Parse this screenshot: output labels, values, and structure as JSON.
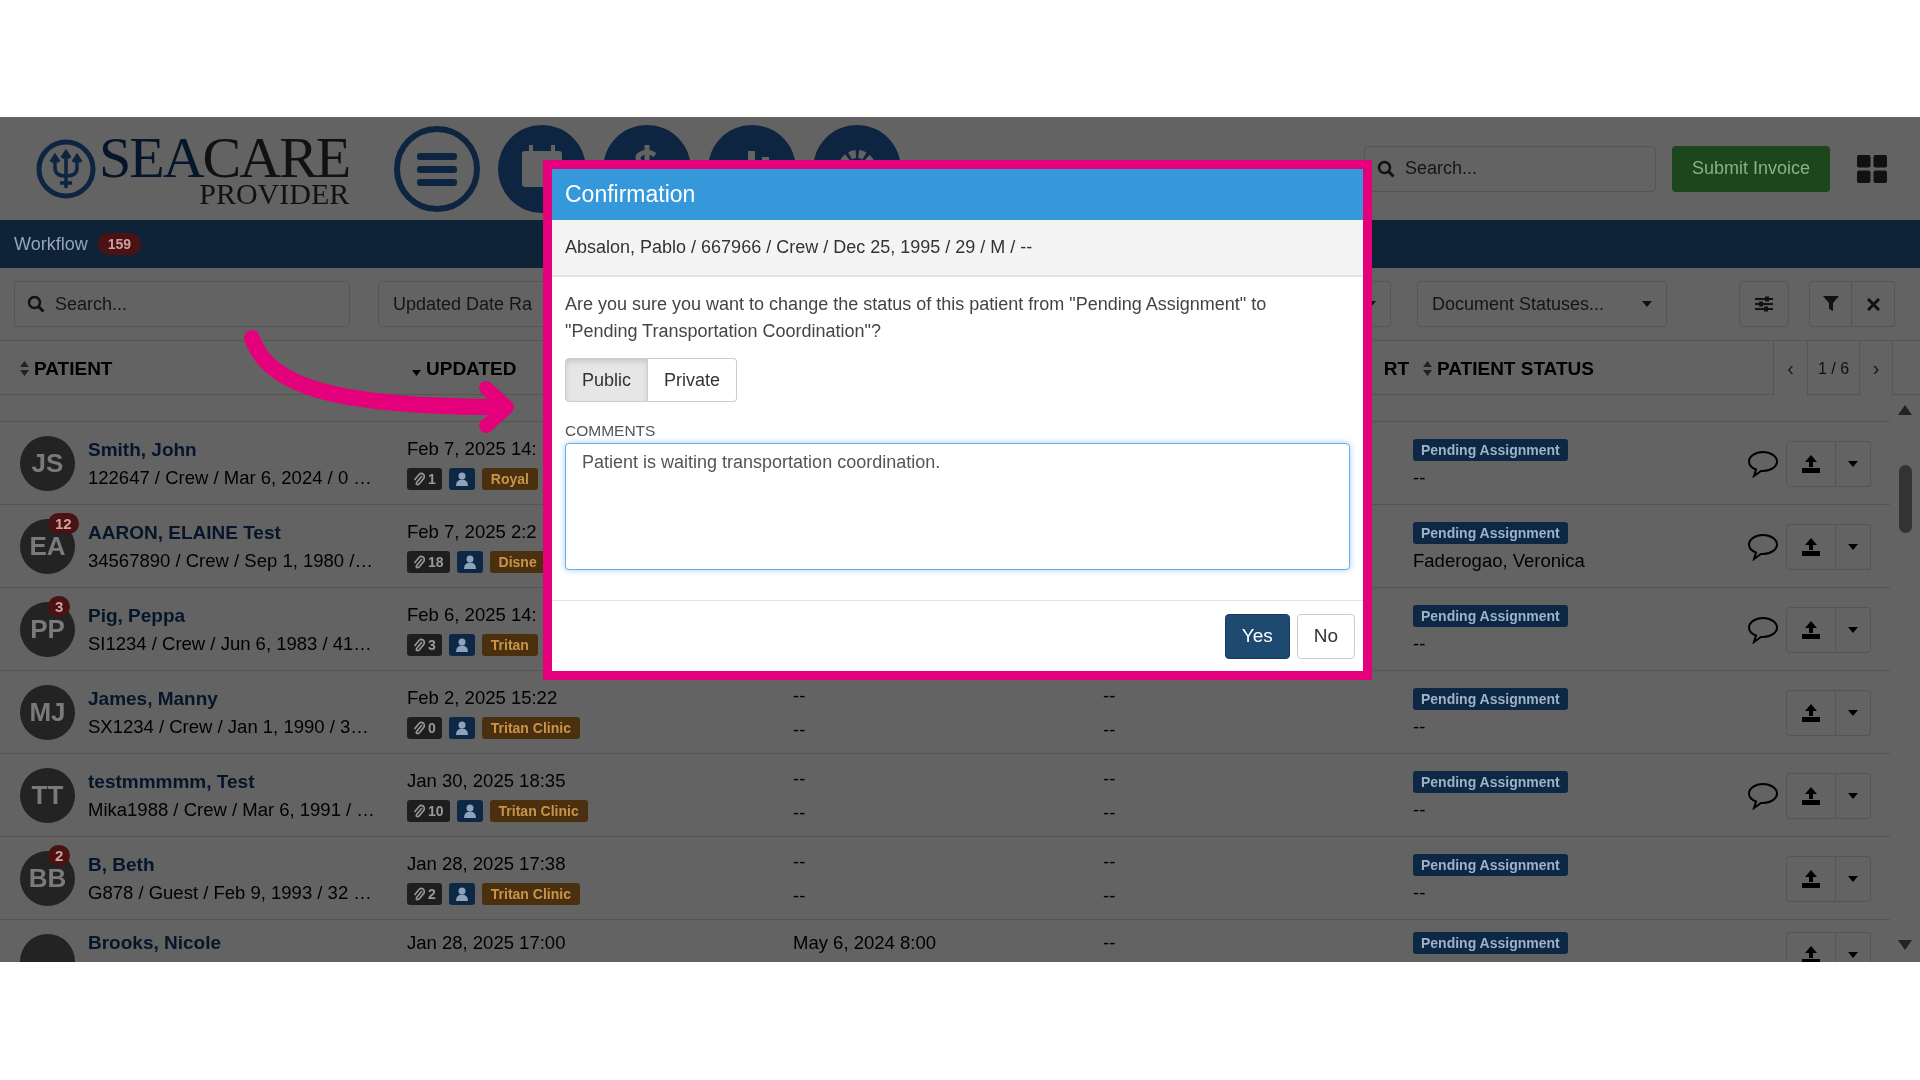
{
  "header": {
    "logo": {
      "primary": "SEA",
      "secondary": "CARE",
      "tagline": "PROVIDER"
    },
    "nav_icons": [
      {
        "kind": "menu"
      },
      {
        "kind": "calendar"
      },
      {
        "kind": "dollar"
      },
      {
        "kind": "chart"
      },
      {
        "kind": "gear"
      }
    ],
    "search": {
      "placeholder": "Search..."
    },
    "submit_button": "Submit Invoice"
  },
  "workflow_bar": {
    "label": "Workflow",
    "count": "159"
  },
  "filters": {
    "search": {
      "placeholder": "Search..."
    },
    "date_range": {
      "placeholder": "Updated Date Ra"
    },
    "document_statuses": {
      "placeholder": "Document Statuses..."
    }
  },
  "table": {
    "header": {
      "patient": {
        "label": "PATIENT",
        "kind": "sortable"
      },
      "updated": {
        "label": "UPDATED",
        "kind": "descending"
      },
      "column_4": {
        "label": "RT"
      },
      "patient_status": {
        "label": "PATIENT STATUS",
        "kind": "sortable"
      }
    },
    "pagination": {
      "prev": "‹",
      "page": "1 / 6",
      "next": "›"
    },
    "rows": [
      {
        "initials": "JS",
        "name": "Smith, John",
        "details": "122647 / Crew / Mar 6, 2024 / 0 …",
        "updated": "Feb 7, 2025 14:",
        "attachments": "1",
        "clinic": "Royal",
        "status": "Pending Assignment",
        "assignee": "--",
        "has_comments": true
      },
      {
        "initials": "EA",
        "badge": "12",
        "name": "AARON, ELAINE Test",
        "details": "34567890 / Crew / Sep 1, 1980 /…",
        "updated": "Feb 7, 2025 2:2",
        "attachments": "18",
        "clinic": "Disne",
        "status": "Pending Assignment",
        "assignee": "Faderogao, Veronica",
        "has_comments": true
      },
      {
        "initials": "PP",
        "badge": "3",
        "name": "Pig, Peppa",
        "details": "SI1234 / Crew / Jun 6, 1983 / 41…",
        "updated": "Feb 6, 2025 14:",
        "attachments": "3",
        "clinic": "Tritan",
        "status": "Pending Assignment",
        "assignee": "--",
        "has_comments": true
      },
      {
        "initials": "MJ",
        "name": "James, Manny",
        "details": "SX1234 / Crew / Jan 1, 1990 / 3…",
        "updated": "Feb 2, 2025 15:22",
        "attachments": "0",
        "clinic": "Tritan Clinic",
        "column_3": [
          "--",
          "--"
        ],
        "column_4": [
          "--",
          "--"
        ],
        "status": "Pending Assignment",
        "assignee": "--",
        "has_comments": false
      },
      {
        "initials": "TT",
        "name": "testmmmmm, Test",
        "details": "Mika1988 / Crew / Mar 6, 1991 / …",
        "updated": "Jan 30, 2025 18:35",
        "attachments": "10",
        "clinic": "Tritan Clinic",
        "column_3": [
          "--",
          "--"
        ],
        "column_4": [
          "--",
          "--"
        ],
        "status": "Pending Assignment",
        "assignee": "--",
        "has_comments": true
      },
      {
        "initials": "BB",
        "badge": "2",
        "name": "B, Beth",
        "details": "G878 / Guest / Feb 9, 1993 / 32 …",
        "updated": "Jan 28, 2025 17:38",
        "attachments": "2",
        "clinic": "Tritan Clinic",
        "column_3": [
          "--",
          "--"
        ],
        "column_4": [
          "--",
          "--"
        ],
        "status": "Pending Assignment",
        "assignee": "--",
        "has_comments": false
      },
      {
        "name": "Brooks, Nicole",
        "updated": "Jan 28, 2025 17:00",
        "column_3": [
          "May 6, 2024 8:00"
        ],
        "column_4": [
          "--"
        ],
        "status": "Pending Assignment",
        "has_comments": false
      }
    ]
  },
  "dialog": {
    "title": "Confirmation",
    "patient_line": "Absalon, Pablo / 667966 / Crew / Dec 25, 1995 / 29 / M / --",
    "question": "Are you sure you want to change the status of this patient from \"Pending Assignment\" to \"Pending Transportation Coordination\"?",
    "visibility": [
      {
        "label": "Public",
        "selected": true
      },
      {
        "label": "Private",
        "selected": false
      }
    ],
    "comments_label": "COMMENTS",
    "comments_value": "Patient is waiting transportation coordination.",
    "buttons": [
      {
        "label": "Yes",
        "kind": "primary"
      },
      {
        "label": "No",
        "kind": "default"
      }
    ]
  }
}
